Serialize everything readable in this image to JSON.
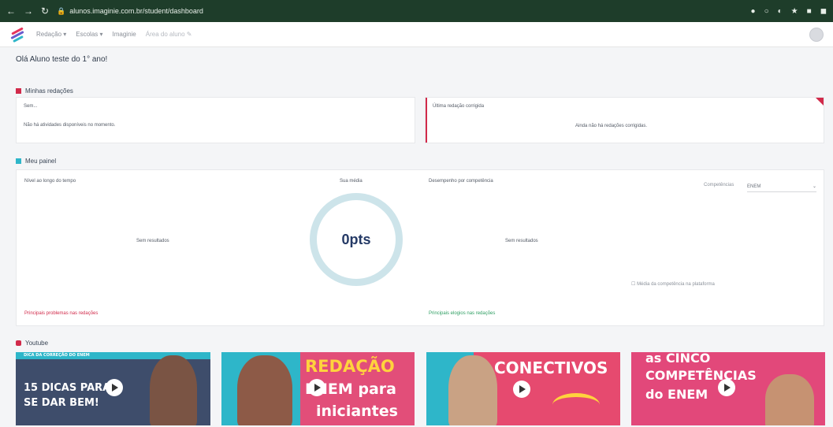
{
  "browser": {
    "url": "alunos.imaginie.com.br/student/dashboard"
  },
  "header": {
    "menu": [
      "Redação ▾",
      "Escolas ▾",
      "Imaginie",
      "Área do aluno ✎"
    ]
  },
  "greeting": "Olá Aluno teste do 1° ano!",
  "sections": {
    "essays": {
      "title": "Minhas redações",
      "left_card": {
        "label": "Sem...",
        "message": "Não há atividades disponíveis no momento."
      },
      "right_card": {
        "label": "Última redação corrigida",
        "message": "Ainda não há redações corrigidas."
      }
    },
    "panel": {
      "title": "Meu painel",
      "left": {
        "label": "Nível ao longo do tempo",
        "center_label": "Sua média",
        "empty": "Sem resultados",
        "footer": "Principais problemas nas redações"
      },
      "score": "0pts",
      "right": {
        "label": "Desempenho por competência",
        "filter_label": "Competências",
        "filter_value": "ENEM",
        "empty": "Sem resultados",
        "note": "Média da competência na plataforma",
        "footer": "Principais elogios nas redações"
      }
    },
    "videos": {
      "title": "Youtube",
      "items": [
        {
          "top": "DICA DA CORREÇÃO DO ENEM",
          "line1": "15 DICAS PARA",
          "line2": "SE DAR BEM!"
        },
        {
          "line1": "REDAÇÃO",
          "line2": "ENEM para",
          "line3": "iniciantes"
        },
        {
          "line1": "CONECTIVOS"
        },
        {
          "line1": "as CINCO",
          "line2": "COMPETÊNCIAS",
          "line3": "do ENEM"
        }
      ]
    }
  },
  "colors": {
    "accent_pink": "#d12a4a",
    "accent_teal": "#2eb6c9",
    "ring": "#cde4ea",
    "score": "#253a66"
  },
  "icons": [
    "back-icon",
    "forward-icon",
    "reload-icon",
    "lock-icon",
    "play-icon",
    "avatar-icon",
    "chevron-down-icon"
  ]
}
